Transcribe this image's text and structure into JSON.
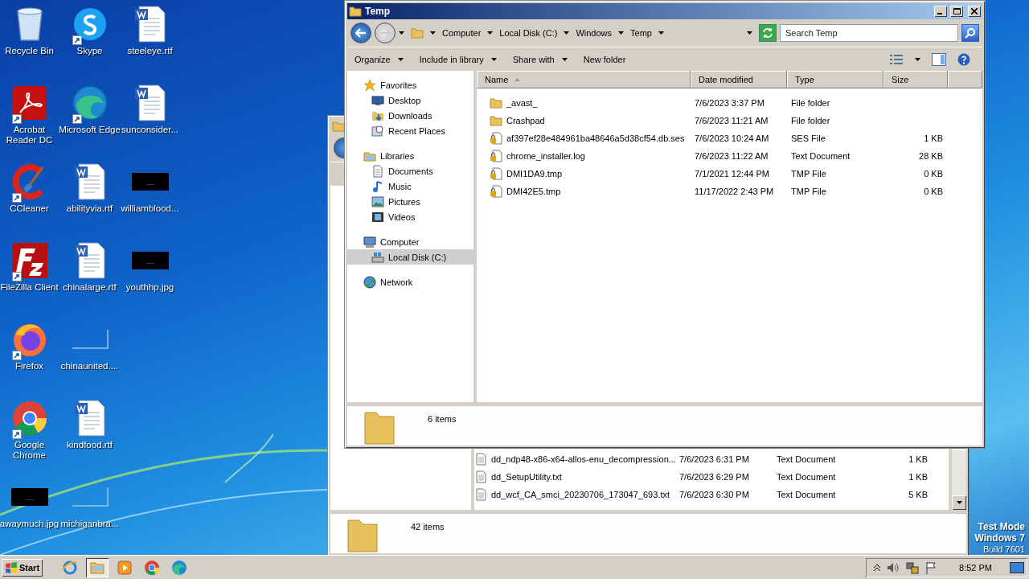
{
  "desktop": {
    "icon_columns": [
      [
        {
          "label": "Recycle Bin",
          "kind": "recycle",
          "shortcut": false
        },
        {
          "label": "Acrobat Reader DC",
          "kind": "acrobat",
          "shortcut": true
        },
        {
          "label": "CCleaner",
          "kind": "ccleaner",
          "shortcut": true
        },
        {
          "label": "FileZilla Client",
          "kind": "filezilla",
          "shortcut": true
        },
        {
          "label": "Firefox",
          "kind": "firefox",
          "shortcut": true
        },
        {
          "label": "Google Chrome",
          "kind": "chrome",
          "shortcut": true
        },
        {
          "label": "awaymuch.jpg",
          "kind": "thumb-dark",
          "shortcut": false
        }
      ],
      [
        {
          "label": "Skype",
          "kind": "skype",
          "shortcut": true
        },
        {
          "label": "Microsoft Edge",
          "kind": "edge",
          "shortcut": true
        },
        {
          "label": "abilityvia.rtf",
          "kind": "word",
          "shortcut": false
        },
        {
          "label": "chinalarge.rtf",
          "kind": "word",
          "shortcut": false
        },
        {
          "label": "chinaunited....",
          "kind": "thumb-blank",
          "shortcut": false
        },
        {
          "label": "kindfood.rtf",
          "kind": "word",
          "shortcut": false
        },
        {
          "label": "michiganbra...",
          "kind": "thumb-blank",
          "shortcut": false
        }
      ],
      [
        {
          "label": "steeleye.rtf",
          "kind": "word",
          "shortcut": false
        },
        {
          "label": "sunconsider...",
          "kind": "word",
          "shortcut": false
        },
        {
          "label": "williamblood...",
          "kind": "thumb-dark",
          "shortcut": false
        },
        {
          "label": "youthhp.jpg",
          "kind": "thumb-dark",
          "shortcut": false
        }
      ]
    ],
    "test_mode": [
      "Test Mode",
      "Windows 7",
      "Build 7601"
    ]
  },
  "back_window": {
    "files": [
      {
        "name": "dd_ndp48-x86-x64-allos-enu_decompression...",
        "date": "7/6/2023 6:31 PM",
        "type": "Text Document",
        "size": "1 KB"
      },
      {
        "name": "dd_SetupUtility.txt",
        "date": "7/6/2023 6:29 PM",
        "type": "Text Document",
        "size": "1 KB"
      },
      {
        "name": "dd_wcf_CA_smci_20230706_173047_693.txt",
        "date": "7/6/2023 6:30 PM",
        "type": "Text Document",
        "size": "5 KB"
      }
    ],
    "status": "42 items"
  },
  "window": {
    "title": "Temp",
    "breadcrumb": [
      "Computer",
      "Local Disk (C:)",
      "Windows",
      "Temp"
    ],
    "search_placeholder": "Search Temp",
    "toolbar": [
      {
        "label": "Organize",
        "dropdown": true
      },
      {
        "label": "Include in library",
        "dropdown": true
      },
      {
        "label": "Share with",
        "dropdown": true
      },
      {
        "label": "New folder",
        "dropdown": false
      }
    ],
    "nav": [
      {
        "label": "Favorites",
        "kind": "star",
        "selected": false,
        "children": [
          {
            "label": "Desktop",
            "kind": "desktop",
            "selected": false
          },
          {
            "label": "Downloads",
            "kind": "downloads",
            "selected": false
          },
          {
            "label": "Recent Places",
            "kind": "recent",
            "selected": false
          }
        ]
      },
      {
        "label": "Libraries",
        "kind": "library",
        "selected": false,
        "children": [
          {
            "label": "Documents",
            "kind": "documents",
            "selected": false
          },
          {
            "label": "Music",
            "kind": "music",
            "selected": false
          },
          {
            "label": "Pictures",
            "kind": "pictures",
            "selected": false
          },
          {
            "label": "Videos",
            "kind": "videos",
            "selected": false
          }
        ]
      },
      {
        "label": "Computer",
        "kind": "computer",
        "selected": false,
        "children": [
          {
            "label": "Local Disk (C:)",
            "kind": "disk",
            "selected": true
          }
        ]
      },
      {
        "label": "Network",
        "kind": "network",
        "selected": false
      }
    ],
    "columns": [
      {
        "label": "Name",
        "sorted": true
      },
      {
        "label": "Date modified",
        "sorted": false
      },
      {
        "label": "Type",
        "sorted": false
      },
      {
        "label": "Size",
        "sorted": false
      }
    ],
    "files": [
      {
        "name": "_avast_",
        "kind": "folder",
        "date": "7/6/2023 3:37 PM",
        "type": "File folder"
      },
      {
        "name": "Crashpad",
        "kind": "folder",
        "date": "7/6/2023 11:21 AM",
        "type": "File folder"
      },
      {
        "name": "af397ef28e484961ba48646a5d38cf54.db.ses",
        "kind": "locked",
        "date": "7/6/2023 10:24 AM",
        "type": "SES File",
        "size": "1 KB"
      },
      {
        "name": "chrome_installer.log",
        "kind": "locked",
        "date": "7/6/2023 11:22 AM",
        "type": "Text Document",
        "size": "28 KB"
      },
      {
        "name": "DMI1DA9.tmp",
        "kind": "locked",
        "date": "7/1/2021 12:44 PM",
        "type": "TMP File",
        "size": "0 KB"
      },
      {
        "name": "DMI42E5.tmp",
        "kind": "locked",
        "date": "11/17/2022 2:43 PM",
        "type": "TMP File",
        "size": "0 KB"
      }
    ],
    "status": "6 items"
  },
  "taskbar": {
    "start": "Start",
    "apps": [
      {
        "kind": "ie",
        "selected": false
      },
      {
        "kind": "explorer",
        "selected": true
      },
      {
        "kind": "media",
        "selected": false
      },
      {
        "kind": "chrome",
        "selected": false
      },
      {
        "kind": "edge",
        "selected": false
      }
    ],
    "clock": "8:52 PM"
  }
}
